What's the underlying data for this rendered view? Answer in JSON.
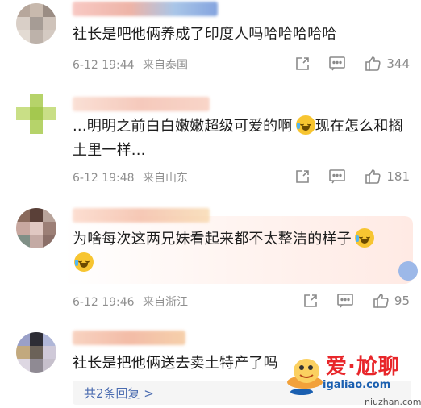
{
  "comments": [
    {
      "text": "社长是吧他俩养成了印度人吗哈哈哈哈哈",
      "time": "6-12 19:44",
      "location": "来自泰国",
      "likes": "344"
    },
    {
      "text": "...明明之前白白嫩嫩超级可爱的啊",
      "text_after": "现在怎么和搁土里一样...",
      "time": "6-12 19:48",
      "location": "来自山东",
      "likes": "181"
    },
    {
      "text": "为啥每次这两兄妹看起来都不太整洁的样子",
      "time": "6-12 19:46",
      "location": "来自浙江",
      "likes": "95"
    },
    {
      "text": "社长是把他俩送去卖土特产了吗",
      "reply_label": "共2条回复 >"
    }
  ],
  "watermark": {
    "title": "爱·尬聊",
    "url": "igaliao.com",
    "url2": "niuzhan.com"
  },
  "icons": {
    "share": "share-icon",
    "comment": "comment-icon",
    "like": "thumbs-up-icon",
    "emoji": "crying-laughing-emoji"
  },
  "colors": {
    "meta": "#8f8f8f",
    "reply_link": "#4a6bb0",
    "watermark_red": "#e8262a"
  }
}
